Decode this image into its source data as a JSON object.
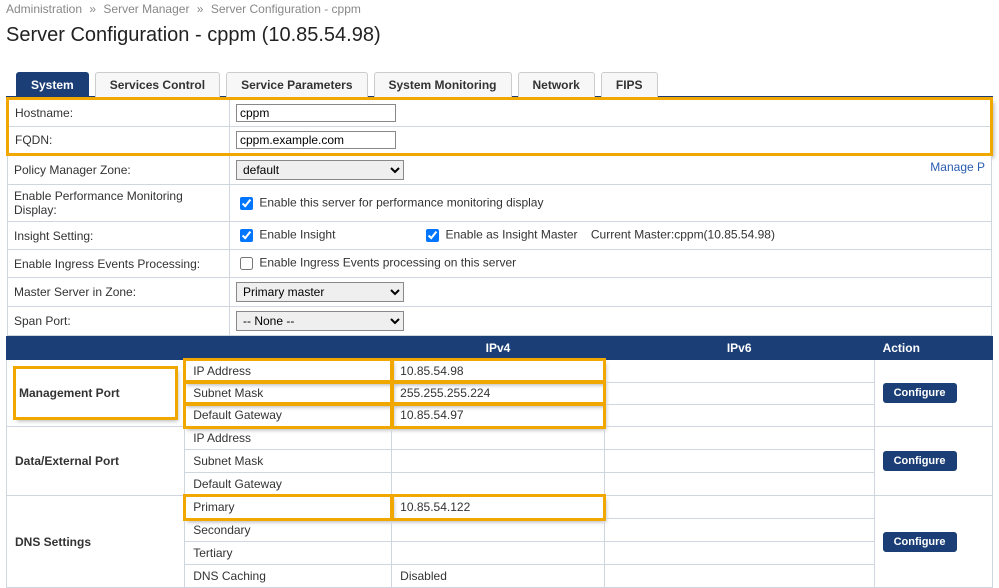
{
  "breadcrumb": {
    "a": "Administration",
    "b": "Server Manager",
    "c": "Server Configuration - cppm"
  },
  "page_title": "Server Configuration - cppm (10.85.54.98)",
  "tabs": {
    "system": "System",
    "services": "Services Control",
    "params": "Service Parameters",
    "monitor": "System Monitoring",
    "network": "Network",
    "fips": "FIPS"
  },
  "form": {
    "hostname_label": "Hostname:",
    "hostname_value": "cppm",
    "fqdn_label": "FQDN:",
    "fqdn_value": "cppm.example.com",
    "zone_label": "Policy Manager Zone:",
    "zone_value": "default",
    "zone_manage": "Manage P",
    "perf_label": "Enable Performance Monitoring Display:",
    "perf_text": "Enable this server for performance monitoring display",
    "insight_label": "Insight Setting:",
    "insight_enable": "Enable Insight",
    "insight_master": "Enable as Insight Master",
    "insight_current": "Current Master:cppm(10.85.54.98)",
    "ingress_label": "Enable Ingress Events Processing:",
    "ingress_text": "Enable Ingress Events processing on this server",
    "master_label": "Master Server in Zone:",
    "master_value": "Primary master",
    "span_label": "Span Port:",
    "span_value": "-- None --"
  },
  "ports": {
    "hdr_ipv4": "IPv4",
    "hdr_ipv6": "IPv6",
    "hdr_action": "Action",
    "mgmt_label": "Management Port",
    "mgmt_rows": {
      "ip_l": "IP Address",
      "ip_v": "10.85.54.98",
      "mask_l": "Subnet Mask",
      "mask_v": "255.255.255.224",
      "gw_l": "Default Gateway",
      "gw_v": "10.85.54.97"
    },
    "data_label": "Data/External Port",
    "data_rows": {
      "ip_l": "IP Address",
      "mask_l": "Subnet Mask",
      "gw_l": "Default Gateway"
    },
    "dns_label": "DNS Settings",
    "dns_rows": {
      "pri_l": "Primary",
      "pri_v": "10.85.54.122",
      "sec_l": "Secondary",
      "ter_l": "Tertiary",
      "cache_l": "DNS Caching",
      "cache_v": "Disabled"
    },
    "configure": "Configure"
  }
}
